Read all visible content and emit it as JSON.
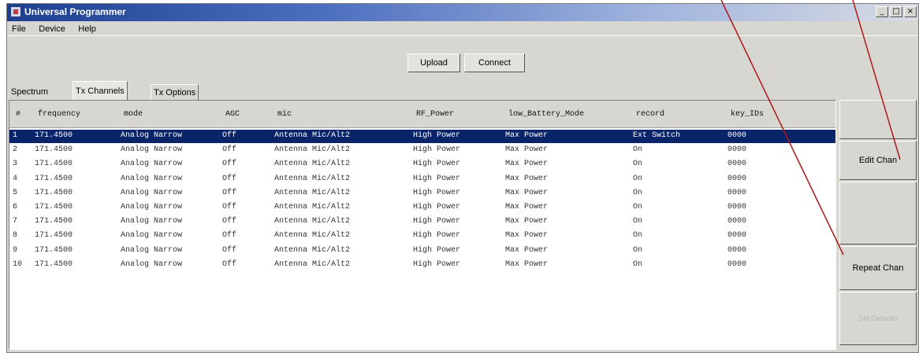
{
  "window": {
    "title": "Universal Programmer",
    "controls": {
      "minimize": "_",
      "maximize": "□",
      "close": "×"
    }
  },
  "menu": [
    "File",
    "Device",
    "Help"
  ],
  "toolbar": {
    "upload_label": "Upload",
    "connect_label": "Connect"
  },
  "tabs": [
    {
      "label": "Spectrum"
    },
    {
      "label": "Tx Channels"
    },
    {
      "label": "Tx Options"
    }
  ],
  "table": {
    "columns": [
      "#",
      "frequency",
      "mode",
      "AGC",
      "mic",
      "RF_Power",
      "low_Battery_Mode",
      "record",
      "key_IDs"
    ],
    "rows": [
      [
        "1",
        "171.4500",
        "Analog Narrow",
        "Off",
        "Antenna Mic/Alt2",
        "High Power",
        "Max Power",
        "Ext Switch",
        "0000"
      ],
      [
        "2",
        "171.4500",
        "Analog Narrow",
        "Off",
        "Antenna Mic/Alt2",
        "High Power",
        "Max Power",
        "On",
        "0000"
      ],
      [
        "3",
        "171.4500",
        "Analog Narrow",
        "Off",
        "Antenna Mic/Alt2",
        "High Power",
        "Max Power",
        "On",
        "0000"
      ],
      [
        "4",
        "171.4500",
        "Analog Narrow",
        "Off",
        "Antenna Mic/Alt2",
        "High Power",
        "Max Power",
        "On",
        "0000"
      ],
      [
        "5",
        "171.4500",
        "Analog Narrow",
        "Off",
        "Antenna Mic/Alt2",
        "High Power",
        "Max Power",
        "On",
        "0000"
      ],
      [
        "6",
        "171.4500",
        "Analog Narrow",
        "Off",
        "Antenna Mic/Alt2",
        "High Power",
        "Max Power",
        "On",
        "0000"
      ],
      [
        "7",
        "171.4500",
        "Analog Narrow",
        "Off",
        "Antenna Mic/Alt2",
        "High Power",
        "Max Power",
        "On",
        "0000"
      ],
      [
        "8",
        "171.4500",
        "Analog Narrow",
        "Off",
        "Antenna Mic/Alt2",
        "High Power",
        "Max Power",
        "On",
        "0000"
      ],
      [
        "9",
        "171.4500",
        "Analog Narrow",
        "Off",
        "Antenna Mic/Alt2",
        "High Power",
        "Max Power",
        "On",
        "0000"
      ],
      [
        "10",
        "171.4500",
        "Analog Narrow",
        "Off",
        "Antenna Mic/Alt2",
        "High Power",
        "Max Power",
        "On",
        "0000"
      ]
    ],
    "selected_row": 0
  },
  "side_panel": {
    "edit_label": "Edit Chan",
    "repeat_label": "Repeat Chan",
    "disabled_label": "Set Defaults"
  },
  "colors": {
    "selection": "#0a246a",
    "annotation_line": "#b01818"
  }
}
